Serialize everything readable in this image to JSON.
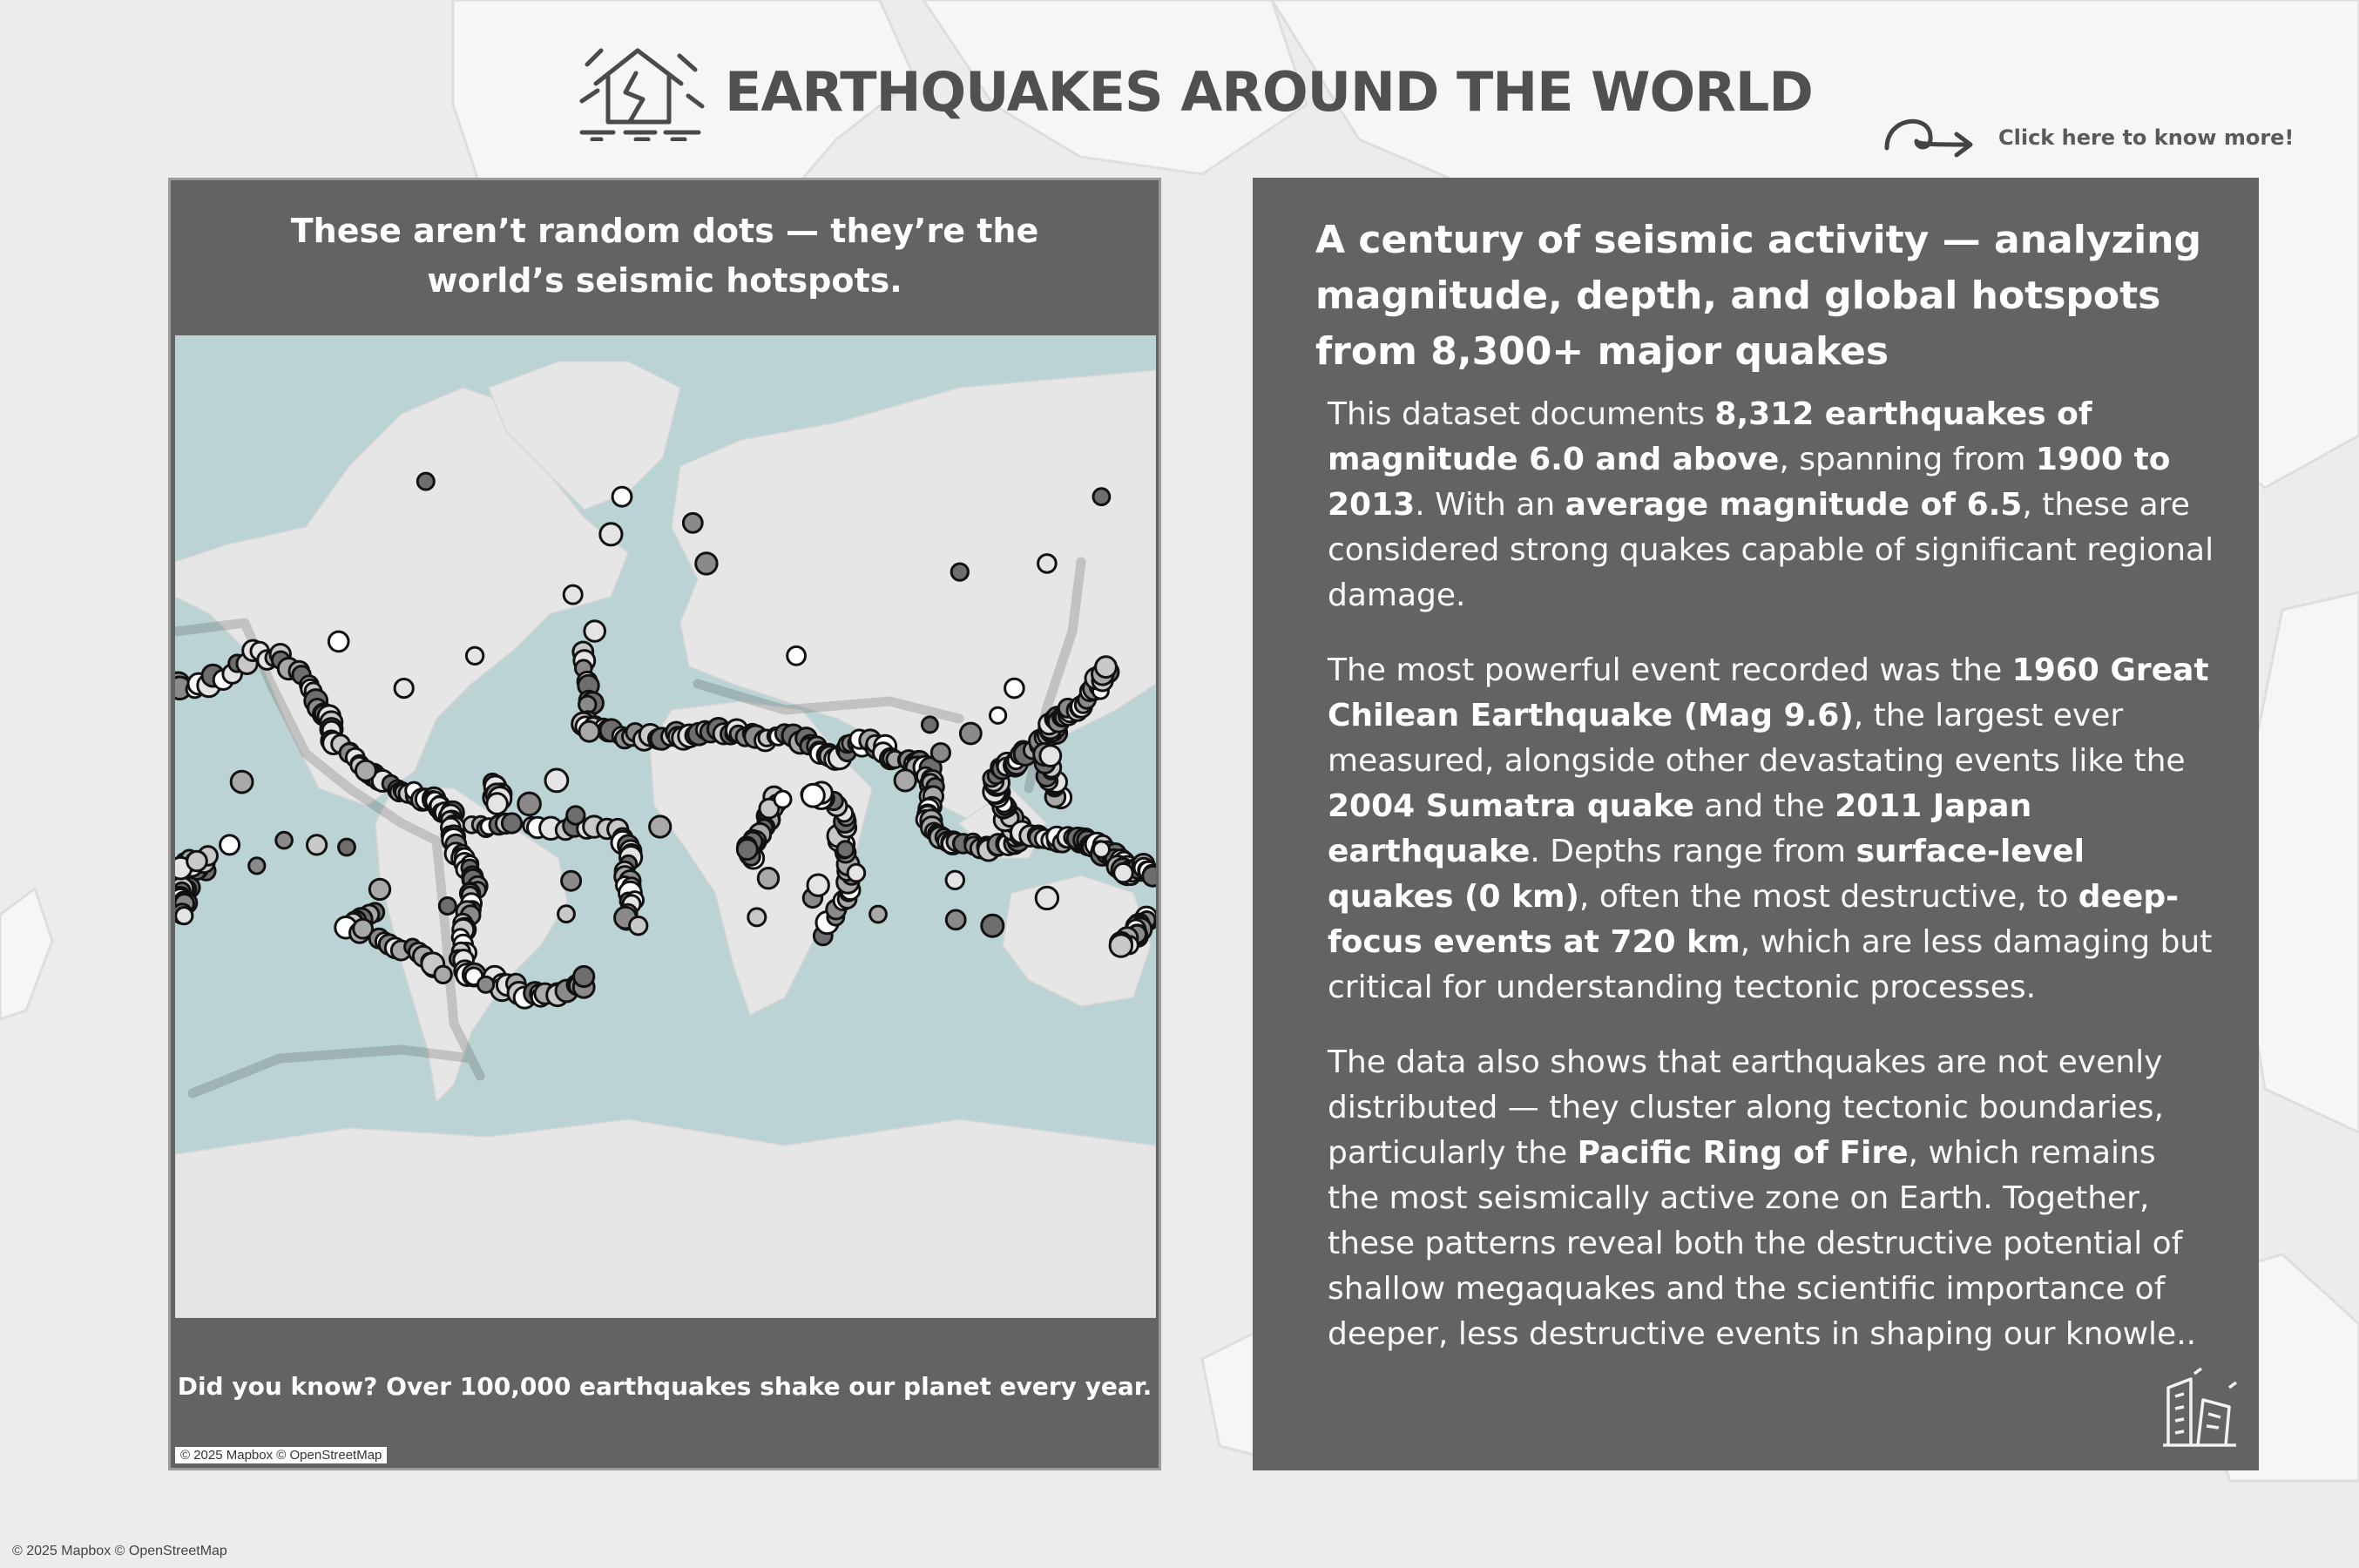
{
  "header": {
    "title": "EARTHQUAKES AROUND THE WORLD",
    "cta": "Click here to know more!"
  },
  "icons": {
    "header": "earthquake-house-icon",
    "cta": "curly-arrow-icon",
    "corner": "collapsed-building-icon"
  },
  "left_panel": {
    "heading_line1": "These aren’t random dots — they’re the",
    "heading_line2": "world’s seismic hotspots.",
    "fact": "Did you know? Over 100,000 earthquakes shake our planet every year.",
    "attribution": "© 2025 Mapbox © OpenStreetMap"
  },
  "right_panel": {
    "heading": "A century of seismic activity — analyzing magnitude, depth, and global hotspots from 8,300+ major quakes",
    "p1": [
      {
        "t": "This dataset documents "
      },
      {
        "t": "8,312 earthquakes of magnitude 6.0 and above",
        "b": true
      },
      {
        "t": ", spanning from "
      },
      {
        "t": "1900 to 2013",
        "b": true
      },
      {
        "t": ". With an "
      },
      {
        "t": "average magnitude of 6.5",
        "b": true
      },
      {
        "t": ", these are considered strong quakes capable of significant regional damage."
      }
    ],
    "p2": [
      {
        "t": "The most powerful event recorded was the "
      },
      {
        "t": "1960 Great Chilean Earthquake (Mag 9.6)",
        "b": true
      },
      {
        "t": ", the largest ever measured, alongside other devastating events like the "
      },
      {
        "t": "2004 Sumatra quake",
        "b": true
      },
      {
        "t": " and the "
      },
      {
        "t": "2011 Japan earthquake",
        "b": true
      },
      {
        "t": ". Depths range from "
      },
      {
        "t": "surface-level quakes (0 km)",
        "b": true
      },
      {
        "t": ", often the most destructive, to "
      },
      {
        "t": "deep-focus events at 720 km",
        "b": true
      },
      {
        "t": ", which are less damaging but critical for understanding tectonic processes."
      }
    ],
    "p3": [
      {
        "t": "The data also shows that earthquakes are not evenly distributed — they cluster along tectonic boundaries, particularly the "
      },
      {
        "t": "Pacific Ring of Fire",
        "b": true
      },
      {
        "t": ", which remains the most seismically active zone on Earth. Together, these patterns reveal both the destructive potential of shallow megaquakes and the scientific importance of deeper, less destructive events in shaping our knowle.."
      }
    ]
  },
  "footer": {
    "attribution": "© 2025 Mapbox © OpenStreetMap"
  },
  "map": {
    "colors": {
      "ocean": "#bcd3d5",
      "land": "#e6e6e6",
      "ice": "#eeeeee"
    },
    "marker_fills": [
      "#ffffff",
      "#e4e4e4",
      "#c8c8c8",
      "#a8a8a8",
      "#8a8a8a",
      "#6e6e6e"
    ],
    "hotspots": [
      [
        -155.5,
        19.4
      ],
      [
        -178.0,
        -18.0
      ],
      [
        -172.0,
        -15.0
      ],
      [
        -150.0,
        -17.0
      ],
      [
        -110.0,
        24.0
      ],
      [
        -30.0,
        -55.0
      ],
      [
        -10.0,
        -40.0
      ],
      [
        -28.0,
        38.7
      ],
      [
        -26.0,
        65.0
      ],
      [
        -66.0,
        -57.0
      ],
      [
        -80.0,
        -33.0
      ],
      [
        -140.0,
        -6.0
      ],
      [
        -160.0,
        -8.0
      ],
      [
        -128.0,
        -8.0
      ],
      [
        -117.0,
        -9.0
      ],
      [
        78.0,
        -36.0
      ],
      [
        108.0,
        74.0
      ],
      [
        -88.0,
        82.0
      ],
      [
        160.0,
        81.0
      ],
      [
        140.0,
        75.0
      ],
      [
        -16.0,
        81.0
      ],
      [
        -20.0,
        78.0
      ],
      [
        -34.0,
        71.0
      ],
      [
        10.0,
        79.0
      ],
      [
        15.0,
        75.0
      ],
      [
        30.0,
        -10.0
      ],
      [
        38.0,
        8.0
      ],
      [
        43.0,
        12.0
      ],
      [
        54.0,
        -30.0
      ],
      [
        56.0,
        -25.0
      ],
      [
        70.0,
        -20.0
      ],
      [
        66.0,
        -10.0
      ],
      [
        88.0,
        20.0
      ],
      [
        101.0,
        31.0
      ],
      [
        97.0,
        41.0
      ],
      [
        112.0,
        38.0
      ],
      [
        122.0,
        44.0
      ],
      [
        128.0,
        52.0
      ],
      [
        160.0,
        -10.0
      ],
      [
        168.0,
        -20.0
      ],
      [
        -2.0,
        0.0
      ],
      [
        -40.0,
        20.0
      ],
      [
        -50.0,
        10.0
      ],
      [
        -33.0,
        5.0
      ],
      [
        140.0,
        -30.0
      ],
      [
        120.0,
        -40.0
      ],
      [
        -96.0,
        52.0
      ],
      [
        -70.0,
        60.0
      ],
      [
        -120.0,
        63.0
      ],
      [
        48.0,
        60.0
      ]
    ]
  }
}
